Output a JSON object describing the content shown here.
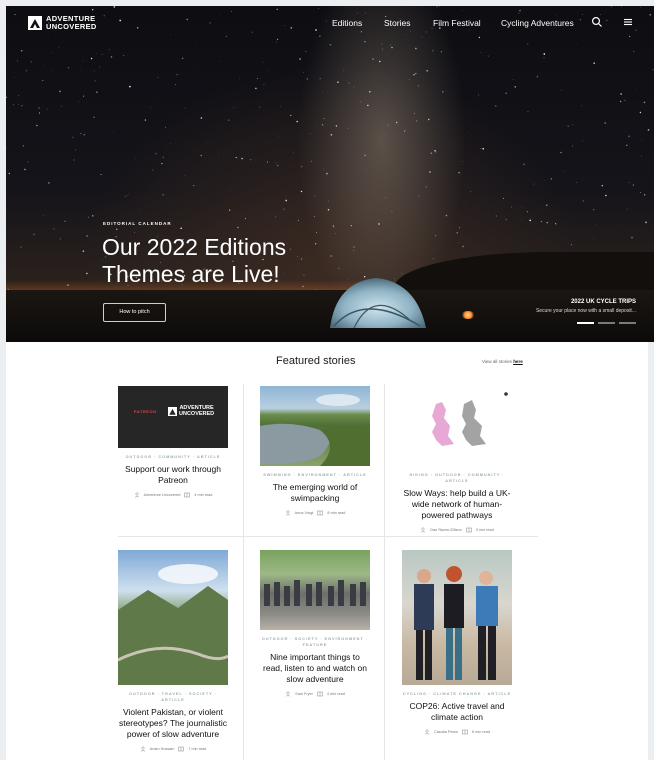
{
  "site": {
    "logo_line1": "ADVENTURE",
    "logo_line2": "UNCOVERED"
  },
  "nav": {
    "links": [
      "Editions",
      "Stories",
      "Film Festival",
      "Cycling Adventures"
    ],
    "icons": [
      "search-icon",
      "menu-icon"
    ]
  },
  "hero": {
    "kicker": "EDITORIAL CALENDAR",
    "title_line1": "Our 2022 Editions",
    "title_line2": "Themes are Live!",
    "button": "How to pitch",
    "promo_title": "2022 UK CYCLE TRIPS",
    "promo_sub": "Secure your place now with a small deposit...",
    "slide_count": 3,
    "active_slide": 1
  },
  "featured": {
    "title": "Featured stories",
    "view_all_prefix": "View all stories ",
    "view_all_link": "here",
    "cards": [
      {
        "image": "patreon",
        "tags": "OUTDOOR · COMMUNITY · ARTICLE",
        "title": "Support our work through Patreon",
        "author": "Adventure Uncovered",
        "read": "4 min read",
        "patreon_word": "PATREON"
      },
      {
        "image": "swimpacking",
        "tags": "SWIMMING · ENVIRONMENT · ARTICLE",
        "title": "The emerging world of swimpacking",
        "author": "Anna Vorgt",
        "read": "8 min read"
      },
      {
        "image": "map",
        "tags": "HIKING · OUTDOOR · COMMUNITY · ARTICLE",
        "title": "Slow Ways: help build a UK-wide network of human-powered pathways",
        "author": "Dan Raven-Ellison",
        "read": "3 min read"
      },
      {
        "image": "pakistan",
        "tags": "OUTDOOR · TRAVEL · SOCIETY · ARTICLE",
        "title": "Violent Pakistan, or violent stereotypes? The journalistic power of slow adventure",
        "author": "Anam Hussain",
        "read": "7 min read"
      },
      {
        "image": "group",
        "tags": "OUTDOOR · SOCIETY · ENVIRONMENT · FEATURE",
        "title": "Nine important things to read, listen to and watch on slow adventure",
        "author": "Sam Fryer",
        "read": "4 min read"
      },
      {
        "image": "cop26",
        "tags": "CYCLING · CLIMATE CHANGE · ARTICLE",
        "title": "COP26: Active travel and climate action",
        "author": "Claudia Pearn",
        "read": "6 min read"
      }
    ]
  },
  "colors": {
    "hero_bg": "#15141a",
    "accent_red": "#e04040",
    "page_bg": "#eceff1"
  }
}
